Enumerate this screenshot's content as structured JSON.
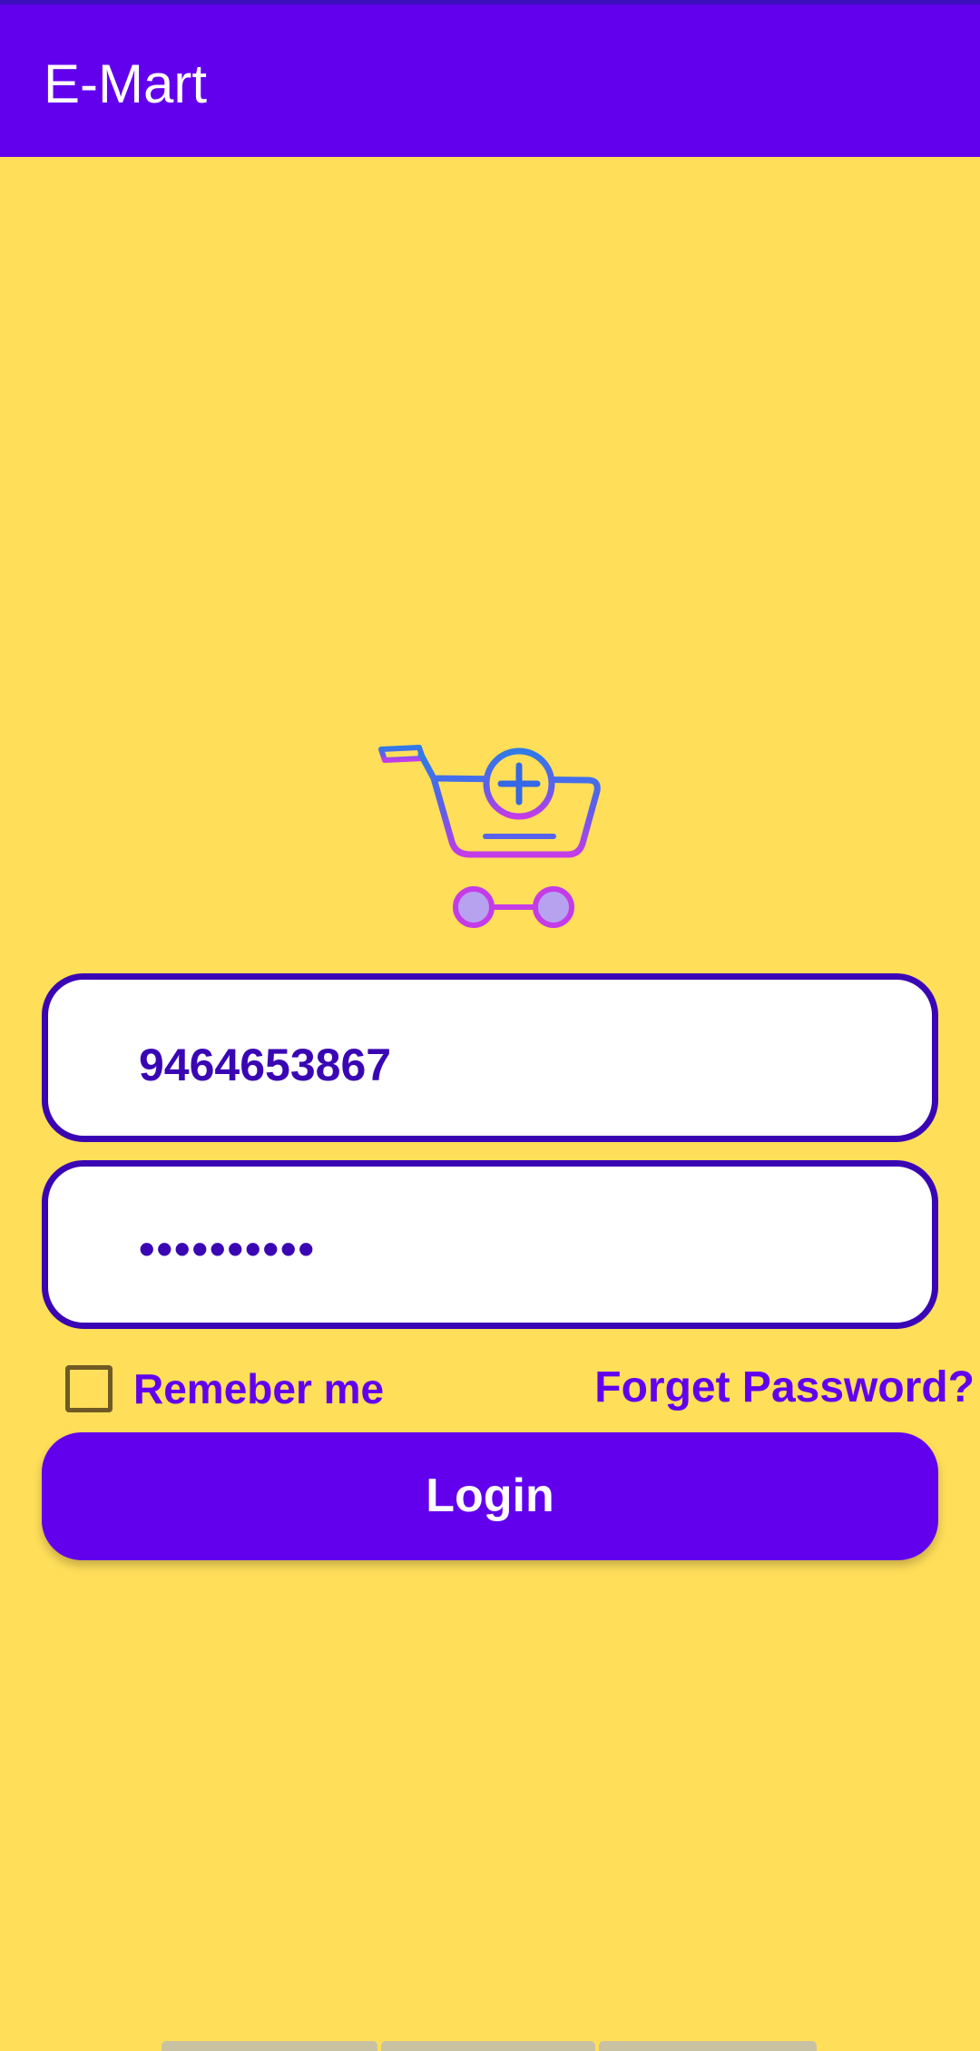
{
  "app_bar": {
    "title": "E-Mart",
    "color": "#6200EE"
  },
  "logo": {
    "icon": "shopping-cart-add-icon"
  },
  "login_form": {
    "phone_value": "9464653867",
    "password_value": "••••••••••",
    "remember_label": "Remeber me",
    "remember_checked": false,
    "forgot_label": "Forget Password?",
    "login_label": "Login"
  },
  "colors": {
    "background": "#FFDE5A",
    "accent": "#6200EE",
    "field_border": "#3A06B4"
  }
}
